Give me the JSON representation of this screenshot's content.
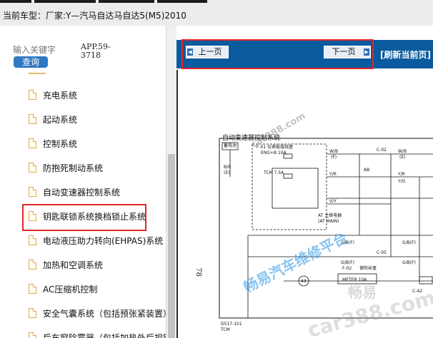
{
  "header": {
    "car_label": "当前车型：",
    "car_model": "厂家:Y—汽马自达马自达5(M5)2010"
  },
  "search": {
    "placeholder": "输入关键字",
    "query_label": "查询",
    "app_version": "APP.59-3718"
  },
  "tree": {
    "items": [
      {
        "label": "充电系统"
      },
      {
        "label": "起动系统"
      },
      {
        "label": "控制系统"
      },
      {
        "label": "防抱死制动系统"
      },
      {
        "label": "自动变速器控制系统"
      },
      {
        "label": "钥匙联锁系统换档锁止系统"
      },
      {
        "label": "电动液压助力转向(EHPAS)系统"
      },
      {
        "label": "加热和空调系统"
      },
      {
        "label": "AC压缩机控制"
      },
      {
        "label": "安全气囊系统（包括预张紧装置）"
      },
      {
        "label": "后车窗除雾器（包括加热外后视镜）"
      }
    ],
    "selected_index": 4
  },
  "nav": {
    "prev_label": "上一页",
    "next_label": "下一页",
    "refresh_label": "[刷新当前页]"
  },
  "diagram": {
    "title": "自动变速器控制系统",
    "page_number": "78",
    "labels": {
      "fuse_box": "F-01 仪表板接线盒",
      "fuse": "ENG+B 10A",
      "tcm_fuse": "TCM 7.5A",
      "battery": "蓄电池",
      "wire_br": "B/R",
      "wire_e": "(E)",
      "relay": "AT 主继电器",
      "relay_en": "(AT MAIN)",
      "wb1": "W/B",
      "wb2": "W/B",
      "yr1": "Y/R",
      "yr2": "Y/R",
      "vy": "V/Y",
      "ab": "AB",
      "yg": "Y/G",
      "c02": "C-02",
      "c05": "C-05",
      "c42": "C-42",
      "gb1": "G/B(F)",
      "gb2": "G/B(F)",
      "gb3": "G/B(F)",
      "gb4": "G/B(F)",
      "f02": "F-02",
      "f02b": "保险丝盒",
      "meter": "METER 10A",
      "num43": "43",
      "bottom_code": "D517-101",
      "bottom_tcm": "TCM",
      "e_label": "(E)",
      "f_label": "(F)"
    }
  },
  "watermarks": {
    "main": "畅易汽车维修平台",
    "site": "car388.com",
    "brand": "畅易",
    "site_bottom": "car388.com"
  }
}
